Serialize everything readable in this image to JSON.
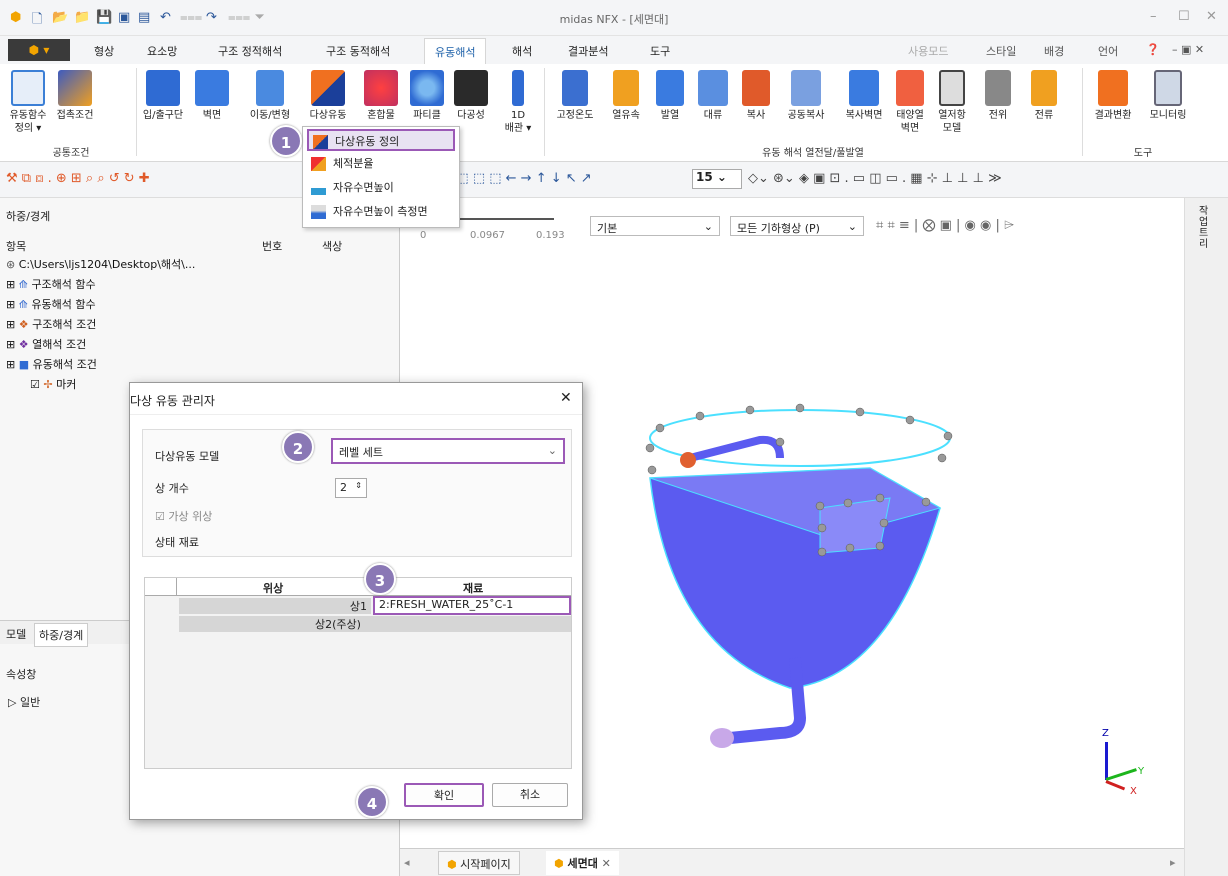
{
  "window": {
    "title": "midas NFX - [세면대]"
  },
  "quick_access_icons": [
    "app-icon",
    "new-icon",
    "open-icon",
    "open-folder-icon",
    "save-icon",
    "saveas-icon",
    "export-icon",
    "undo-icon",
    "redo-icon",
    "qa-more-icon"
  ],
  "menu": {
    "app_button": "▾",
    "tabs": [
      "형상",
      "요소망",
      "구조 정적해석",
      "구조 동적해석",
      "유동해석",
      "해석",
      "결과분석",
      "도구"
    ],
    "active_tab": "유동해석",
    "right": [
      "사용모드",
      "스타일",
      "배경",
      "언어"
    ]
  },
  "ribbon": {
    "group1": {
      "buttons": [
        "유동함수\n정의 ▾",
        "접촉조건"
      ],
      "label": "공통조건"
    },
    "group2": {
      "buttons": [
        "입/출구단",
        "벽면",
        "이동/변형",
        "다상유동",
        "혼합물",
        "파티클",
        "다공성",
        "1D\n배관 ▾"
      ]
    },
    "group3": {
      "buttons": [
        "고정온도",
        "열유속",
        "발열",
        "대류",
        "복사",
        "공동복사",
        "복사벽면",
        "태양열\n벽면",
        "열저항\n모델",
        "전위",
        "전류"
      ],
      "label": "유동 해석 열전달/풀발열"
    },
    "group4": {
      "buttons": [
        "결과변환",
        "모니터링"
      ],
      "label": "도구"
    }
  },
  "toolbar2": {
    "zoom_value": "15"
  },
  "dropdown_menu": {
    "items": [
      "다상유동 정의",
      "체적분율",
      "자유수면높이",
      "자유수면높이 측정면"
    ]
  },
  "left_panel": {
    "title": "하중/경계",
    "columns": [
      "항목",
      "번호",
      "색상"
    ],
    "root": "C:\\Users\\ljs1204\\Desktop\\해석\\...",
    "tree": [
      "구조해석 함수",
      "유동해석 함수",
      "구조해석 조건",
      "열해석 조건",
      "유동해석 조건",
      "마커"
    ],
    "tabs": [
      "모델",
      "하중/경계"
    ],
    "property_title": "속성창",
    "property_group": "일반"
  },
  "viewport": {
    "scale_ticks": [
      "0",
      "0.0967",
      "0.193"
    ],
    "view_mode": "기본",
    "filter": "모든 기하형상 (P)",
    "axes": {
      "z": "Z",
      "y": "Y",
      "x": "X"
    }
  },
  "bottom_tabs": [
    "시작페이지",
    "세면대"
  ],
  "right_strip": {
    "label": "작업트리"
  },
  "dialog": {
    "title": "다상 유동 관리자",
    "model_label": "다상유동 모델",
    "model_value": "레벨 세트",
    "phase_count_label": "상 개수",
    "phase_count_value": "2",
    "virtual_phase_label": "가상 위상",
    "material_label": "상태 재료",
    "grid_headers": [
      "위상",
      "재료"
    ],
    "rows": [
      {
        "phase": "상1",
        "material": "2:FRESH_WATER_25˚C-1"
      },
      {
        "phase": "상2(주상)",
        "material": ""
      }
    ],
    "ok": "확인",
    "cancel": "취소"
  },
  "steps": [
    "1",
    "2",
    "3",
    "4"
  ],
  "colors": {
    "accent": "#9b59b6",
    "mesh": "#5b5bf0",
    "step_badge": "#8a78b5"
  }
}
